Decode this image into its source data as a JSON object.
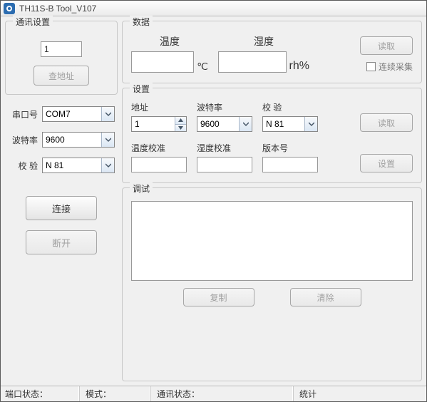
{
  "window": {
    "title": "TH11S-B Tool_V107"
  },
  "comm": {
    "legend": "通讯设置",
    "address_value": "1",
    "check_address_btn": "查地址",
    "port_label": "串口号",
    "port_value": "COM7",
    "baud_label": "波特率",
    "baud_value": "9600",
    "parity_label": "校  验",
    "parity_value": "N 81",
    "connect_btn": "连接",
    "disconnect_btn": "断开"
  },
  "data": {
    "legend": "数据",
    "temp_label": "温度",
    "temp_value": "",
    "temp_unit": "℃",
    "hum_label": "湿度",
    "hum_value": "",
    "hum_unit": "rh%",
    "read_btn": "读取",
    "continuous_label": "连续采集"
  },
  "settings": {
    "legend": "设置",
    "addr_label": "地址",
    "addr_value": "1",
    "baud_label": "波特率",
    "baud_value": "9600",
    "parity_label": "校  验",
    "parity_value": "N 81",
    "read_btn": "读取",
    "temp_cal_label": "温度校准",
    "temp_cal_value": "",
    "hum_cal_label": "湿度校准",
    "hum_cal_value": "",
    "version_label": "版本号",
    "version_value": "",
    "set_btn": "设置"
  },
  "debug": {
    "legend": "调试",
    "text": "",
    "copy_btn": "复制",
    "clear_btn": "清除"
  },
  "status": {
    "port_state": "端口状态：",
    "mode": "模式：",
    "comm_state": "通讯状态：",
    "stats": "统计"
  }
}
